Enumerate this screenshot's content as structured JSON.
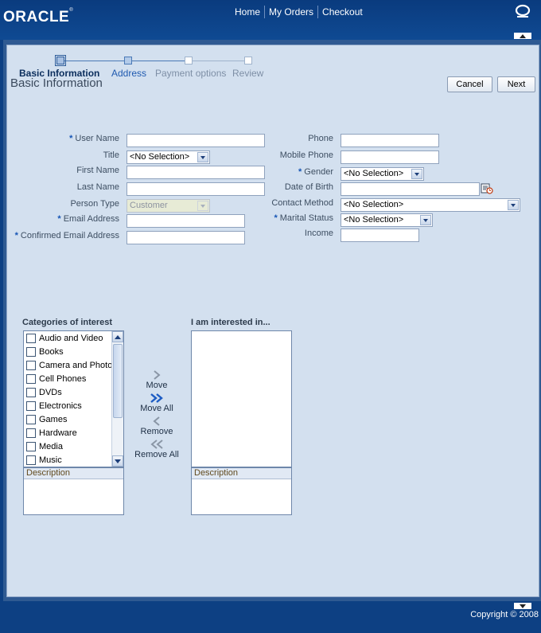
{
  "header": {
    "logo_text": "ORACLE",
    "nav": [
      "Home",
      "My Orders",
      "Checkout"
    ]
  },
  "train": {
    "steps": [
      {
        "label": "Basic Information",
        "state": "current"
      },
      {
        "label": "Address",
        "state": "next"
      },
      {
        "label": "Payment options",
        "state": "disabled"
      },
      {
        "label": "Review",
        "state": "disabled"
      }
    ]
  },
  "page_title": "Basic Information",
  "buttons": {
    "cancel": "Cancel",
    "next": "Next"
  },
  "required_marker": "*",
  "form_left": {
    "user_name": {
      "label": "User Name",
      "value": ""
    },
    "title": {
      "label": "Title",
      "value": "<No Selection>"
    },
    "first_name": {
      "label": "First Name",
      "value": ""
    },
    "last_name": {
      "label": "Last Name",
      "value": ""
    },
    "person_type": {
      "label": "Person Type",
      "value": "Customer"
    },
    "email": {
      "label": "Email Address",
      "value": ""
    },
    "confirm_email": {
      "label": "Confirmed Email Address",
      "value": ""
    }
  },
  "form_right": {
    "phone": {
      "label": "Phone",
      "value": ""
    },
    "mobile_phone": {
      "label": "Mobile Phone",
      "value": ""
    },
    "gender": {
      "label": "Gender",
      "value": "<No Selection>"
    },
    "date_of_birth": {
      "label": "Date of Birth",
      "value": ""
    },
    "contact_method": {
      "label": "Contact Method",
      "value": "<No Selection>"
    },
    "marital_status": {
      "label": "Marital Status",
      "value": "<No Selection>"
    },
    "income": {
      "label": "Income",
      "value": ""
    }
  },
  "shuttle": {
    "leading_header": "Categories of interest",
    "trailing_header": "I am interested in...",
    "categories": [
      "Audio and Video",
      "Books",
      "Camera and Photo",
      "Cell Phones",
      "DVDs",
      "Electronics",
      "Games",
      "Hardware",
      "Media",
      "Music"
    ],
    "description_label": "Description",
    "move": "Move",
    "move_all": "Move All",
    "remove": "Remove",
    "remove_all": "Remove All"
  },
  "footer": {
    "copyright": "Copyright © 2008"
  },
  "colors": {
    "header_bg": "#0d4083",
    "panel_bg": "#d3e0ef",
    "required": "#1655b5",
    "link": "#1f5ab0"
  }
}
